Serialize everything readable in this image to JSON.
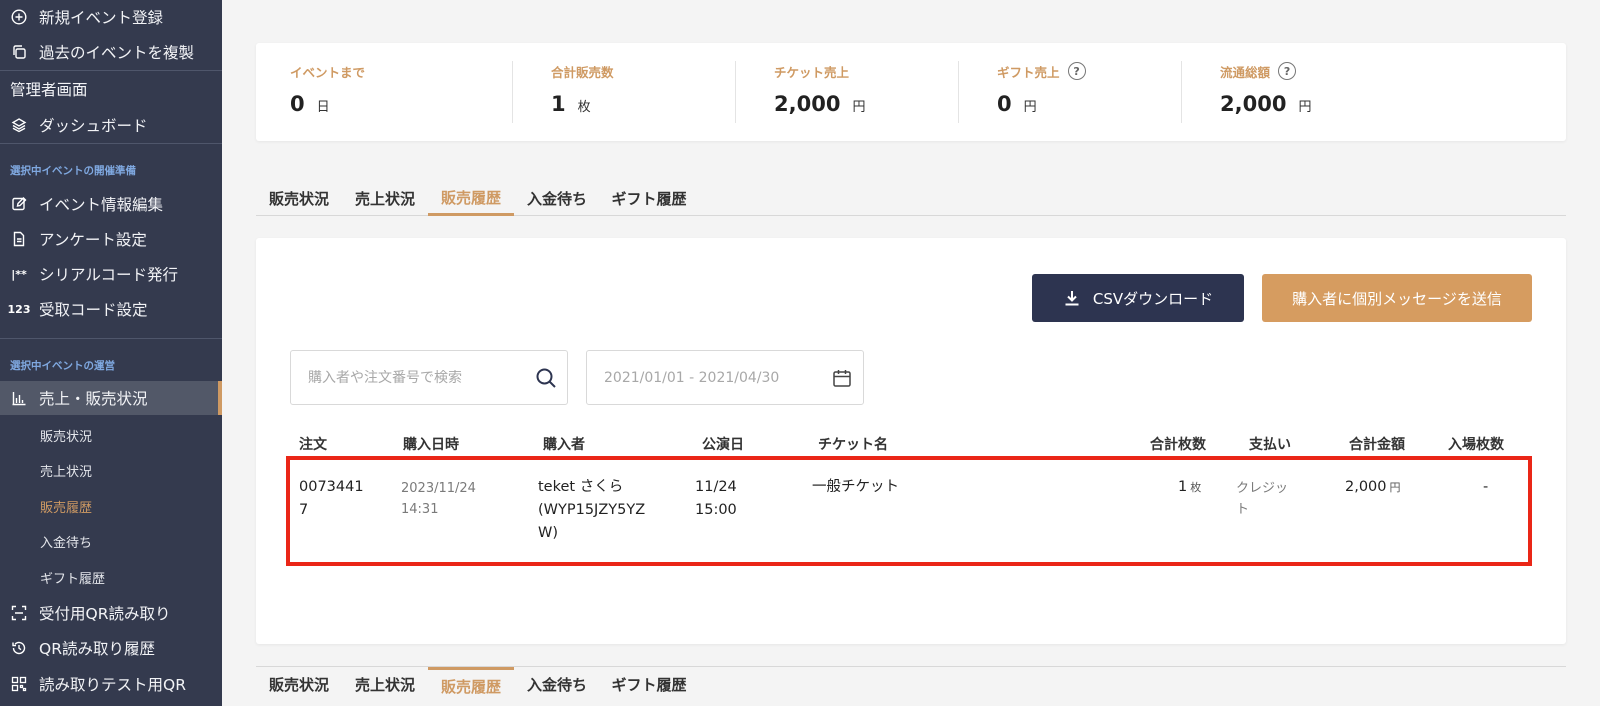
{
  "sidebar": {
    "new_event": "新規イベント登録",
    "duplicate_event": "過去のイベントを複製",
    "admin_screen": "管理者画面",
    "dashboard": "ダッシュボード",
    "section_prep": "選択中イベントの開催準備",
    "edit_event": "イベント情報編集",
    "survey": "アンケート設定",
    "serial_code": "シリアルコード発行",
    "receive_code": "受取コード設定",
    "section_ops": "選択中イベントの運営",
    "sales": "売上・販売状況",
    "sub_items": [
      "販売状況",
      "売上状況",
      "販売履歴",
      "入金待ち",
      "ギフト履歴"
    ],
    "qr_read": "受付用QR読み取り",
    "qr_history": "QR読み取り履歴",
    "qr_test": "読み取りテスト用QR"
  },
  "stats": {
    "until_event": {
      "label": "イベントまで",
      "value": "0",
      "unit": "日"
    },
    "total_sold": {
      "label": "合計販売数",
      "value": "1",
      "unit": "枚"
    },
    "ticket_sales": {
      "label": "チケット売上",
      "value": "2,000",
      "unit": "円"
    },
    "gift_sales": {
      "label": "ギフト売上",
      "value": "0",
      "unit": "円"
    },
    "gross_total": {
      "label": "流通総額",
      "value": "2,000",
      "unit": "円"
    }
  },
  "tabs": [
    "販売状況",
    "売上状況",
    "販売履歴",
    "入金待ち",
    "ギフト履歴"
  ],
  "active_tab": "販売履歴",
  "actions": {
    "csv": "CSVダウンロード",
    "message": "購入者に個別メッセージを送信"
  },
  "search": {
    "placeholder": "購入者や注文番号で検索"
  },
  "date_range": {
    "placeholder": "2021/01/01 - 2021/04/30"
  },
  "table": {
    "headers": {
      "order": "注文",
      "purchased_at": "購入日時",
      "buyer": "購入者",
      "show_date": "公演日",
      "ticket": "チケット名",
      "qty": "合計枚数",
      "payment": "支払い",
      "amount": "合計金額",
      "admitted": "入場枚数"
    },
    "row": {
      "order_1": "0073441",
      "order_2": "7",
      "date_1": "2023/11/24",
      "date_2": "14:31",
      "buyer_1": "teket さくら",
      "buyer_2": "(WYP15JZY5YZ",
      "buyer_3": "W)",
      "show_1": "11/24",
      "show_2": "15:00",
      "ticket": "一般チケット",
      "qty": "1",
      "qty_unit": "枚",
      "pay_1": "クレジッ",
      "pay_2": "ト",
      "amount": "2,000",
      "amount_unit": "円",
      "admitted": "-"
    }
  },
  "colors": {
    "sidebar_bg": "#343a4e",
    "accent": "#cf9a63",
    "csv_button": "#2d3450",
    "message_button": "#d69c60",
    "highlight": "#ea2617"
  }
}
